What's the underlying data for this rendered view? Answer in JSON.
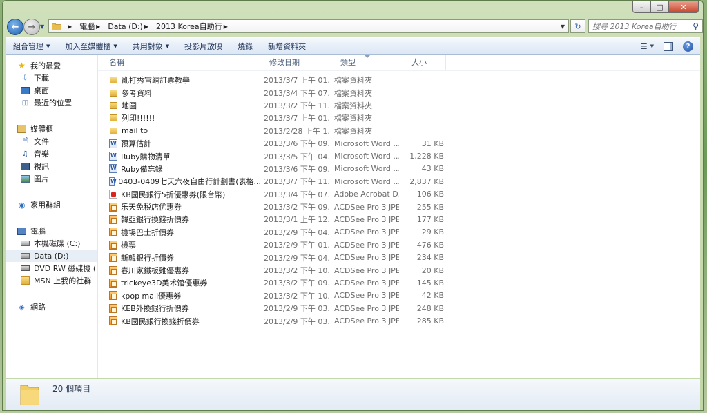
{
  "window": {
    "caption": {
      "minimize": "–",
      "maximize": "□",
      "close": "✕"
    }
  },
  "nav": {
    "back": "←",
    "forward": "→",
    "breadcrumb": [
      "電腦",
      "Data (D:)",
      "2013 Korea自助行"
    ],
    "search_placeholder": "搜尋 2013 Korea自助行"
  },
  "toolbar": {
    "organize": "組合管理",
    "add_to_library": "加入至媒體櫃",
    "share": "共用對象",
    "slideshow": "投影片放映",
    "burn": "燒錄",
    "new_folder": "新增資料夾",
    "help": "?"
  },
  "sidebar": {
    "favorites": {
      "label": "我的最愛",
      "items": [
        "下載",
        "桌面",
        "最近的位置"
      ]
    },
    "libraries": {
      "label": "媒體櫃",
      "items": [
        "文件",
        "音樂",
        "視訊",
        "圖片"
      ]
    },
    "homegroup": "家用群組",
    "computer": {
      "label": "電腦",
      "items": [
        "本機磁碟 (C:)",
        "Data (D:)",
        "DVD RW 磁碟機 (E:)",
        "MSN 上我的社群"
      ]
    },
    "network": "網路"
  },
  "columns": {
    "name": "名稱",
    "date": "修改日期",
    "type": "類型",
    "size": "大小"
  },
  "files": [
    {
      "name": "亂打秀官網訂票教學",
      "date": "2013/3/7 上午 01...",
      "type": "檔案資料夾",
      "size": "",
      "icon": "folder"
    },
    {
      "name": "參考資料",
      "date": "2013/3/4 下午 07...",
      "type": "檔案資料夾",
      "size": "",
      "icon": "folder"
    },
    {
      "name": "地圖",
      "date": "2013/3/2 下午 11...",
      "type": "檔案資料夾",
      "size": "",
      "icon": "folder"
    },
    {
      "name": "列印!!!!!!",
      "date": "2013/3/7 上午 01...",
      "type": "檔案資料夾",
      "size": "",
      "icon": "folder"
    },
    {
      "name": "mail to",
      "date": "2013/2/28 上午 1...",
      "type": "檔案資料夾",
      "size": "",
      "icon": "folder"
    },
    {
      "name": "預算估計",
      "date": "2013/3/6 下午 09...",
      "type": "Microsoft Word ...",
      "size": "31 KB",
      "icon": "word"
    },
    {
      "name": "Ruby購物清單",
      "date": "2013/3/5 下午 04...",
      "type": "Microsoft Word ...",
      "size": "1,228 KB",
      "icon": "word"
    },
    {
      "name": "Ruby備忘錄",
      "date": "2013/3/6 下午 09...",
      "type": "Microsoft Word ...",
      "size": "43 KB",
      "icon": "word"
    },
    {
      "name": "0403-0409七天六夜自由行計劃書(表格...",
      "date": "2013/3/7 下午 11...",
      "type": "Microsoft Word ...",
      "size": "2,837 KB",
      "icon": "word"
    },
    {
      "name": "KB國民銀行5折優惠券(限台幣)",
      "date": "2013/3/4 下午 07...",
      "type": "Adobe Acrobat D...",
      "size": "106 KB",
      "icon": "pdf"
    },
    {
      "name": "乐天免税店优惠券",
      "date": "2013/3/2 下午 09...",
      "type": "ACDSee Pro 3 JPE...",
      "size": "255 KB",
      "icon": "image"
    },
    {
      "name": "韓亞銀行換錢折價券",
      "date": "2013/3/1 上午 12...",
      "type": "ACDSee Pro 3 JPE...",
      "size": "177 KB",
      "icon": "image"
    },
    {
      "name": "機場巴士折價券",
      "date": "2013/2/9 下午 04...",
      "type": "ACDSee Pro 3 JPE...",
      "size": "29 KB",
      "icon": "image"
    },
    {
      "name": "機票",
      "date": "2013/2/9 下午 01...",
      "type": "ACDSee Pro 3 JPE...",
      "size": "476 KB",
      "icon": "image"
    },
    {
      "name": "新韓銀行折價券",
      "date": "2013/2/9 下午 04...",
      "type": "ACDSee Pro 3 JPE...",
      "size": "234 KB",
      "icon": "image"
    },
    {
      "name": "春川家鐵板雞優惠券",
      "date": "2013/3/2 下午 10...",
      "type": "ACDSee Pro 3 JPE...",
      "size": "20 KB",
      "icon": "image"
    },
    {
      "name": "trickeye3D美术馆優惠券",
      "date": "2013/3/2 下午 09...",
      "type": "ACDSee Pro 3 JPE...",
      "size": "145 KB",
      "icon": "image"
    },
    {
      "name": "kpop mall優惠券",
      "date": "2013/3/2 下午 10...",
      "type": "ACDSee Pro 3 JPE...",
      "size": "42 KB",
      "icon": "image"
    },
    {
      "name": "KEB外換銀行折價券",
      "date": "2013/2/9 下午 03...",
      "type": "ACDSee Pro 3 JPE...",
      "size": "248 KB",
      "icon": "image"
    },
    {
      "name": "KB國民銀行換錢折價券",
      "date": "2013/2/9 下午 03...",
      "type": "ACDSee Pro 3 JPE...",
      "size": "285 KB",
      "icon": "image"
    }
  ],
  "status": {
    "count": "20 個項目"
  },
  "colors": {
    "accent": "#1d5fb0",
    "window_frame": "#c2d7a8",
    "folder": "#e2b13c"
  }
}
